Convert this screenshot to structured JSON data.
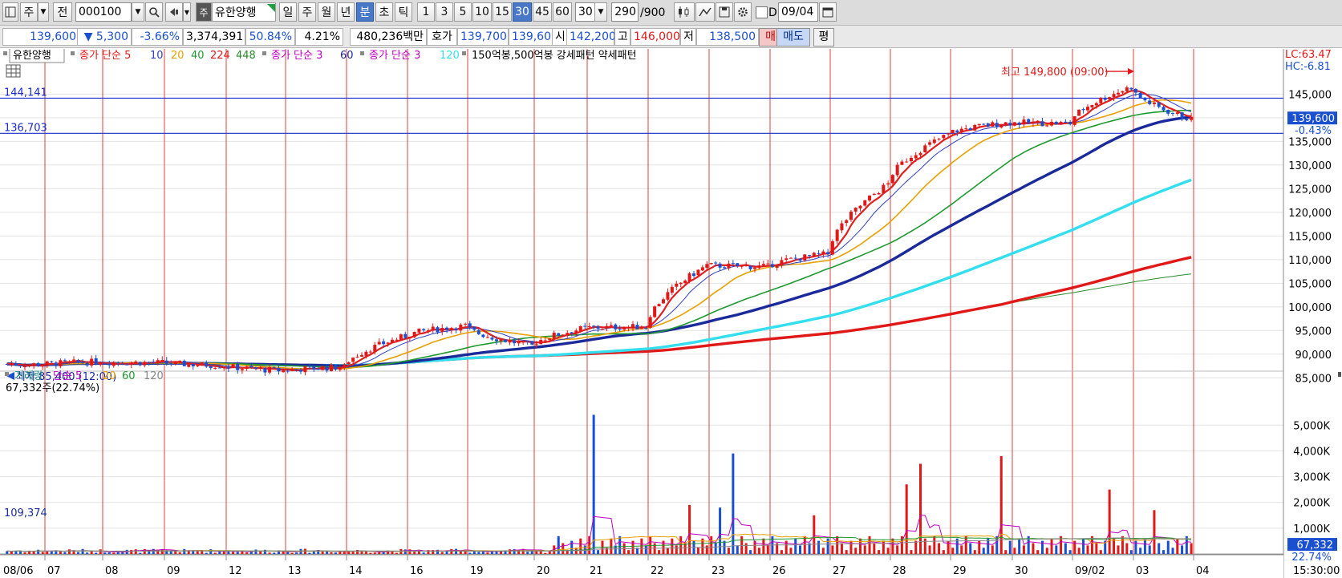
{
  "toolbar": {
    "type_label": "주",
    "prev_label": "전",
    "code": "000100",
    "type_badge": "주",
    "stock_name": "유한양행",
    "periods": [
      "일",
      "주",
      "월",
      "년",
      "분",
      "초",
      "틱"
    ],
    "selected_period": "분",
    "intervals": [
      "1",
      "3",
      "5",
      "10",
      "15",
      "30",
      "45",
      "60"
    ],
    "selected_interval": "30",
    "interval_value": "30",
    "count": "290",
    "count_total": "/900",
    "d_label": "D",
    "date": "09/04"
  },
  "quote": {
    "price": "139,600",
    "change": "▼ 5,300",
    "change_pct": "-3.66%",
    "volume": "3,374,391",
    "volume_ratio": "50.84%",
    "turnover": "4.21%",
    "amount": "480,236백만",
    "hoga_label": "호가",
    "ask": "139,700",
    "bid": "139,600",
    "open_label": "시",
    "open": "142,200",
    "high_label": "고",
    "high": "146,000",
    "low_label": "저",
    "low": "138,500",
    "buy_label": "매수",
    "sell_label": "매도",
    "eval_label": "평"
  },
  "price_legend": {
    "name": "유한양행",
    "ma_label": "종가 단순 5",
    "ma_periods": [
      "10",
      "20",
      "40",
      "224",
      "448"
    ],
    "ma2_label": "종가 단순 3",
    "ma2_period": "60",
    "ma3_label": "종가 단순 3",
    "ma3_period": "120",
    "pattern_text": "150억봉,500억봉 강세패턴  약세패턴"
  },
  "volume_legend": {
    "label": "거래량",
    "ma_label": "단순 5",
    "ma_periods": [
      "20",
      "60",
      "120"
    ],
    "current": "67,332주(22.74%)",
    "ref_value": "109,374"
  },
  "corner_labels": {
    "lc": "LC:63.47",
    "hc": "HC:-6.81",
    "time": "15:30:00"
  },
  "chart_data": {
    "type": "candlestick",
    "price_panel": {
      "ylim": [
        82000,
        151500
      ],
      "y_ticks": [
        85000,
        90000,
        95000,
        100000,
        105000,
        110000,
        115000,
        120000,
        125000,
        130000,
        135000,
        140000,
        145000
      ],
      "y_tick_labels": [
        "85,000",
        "90,000",
        "95,000",
        "100,000",
        "105,000",
        "110,000",
        "115,000",
        "120,000",
        "125,000",
        "130,000",
        "135,000",
        "140,000",
        "145,000"
      ],
      "hlines": [
        {
          "label": "144,141",
          "value": 144141
        },
        {
          "label": "136,703",
          "value": 136703
        }
      ],
      "annotations": [
        {
          "text": "최고 149,800 (09:00)",
          "value": 149800
        },
        {
          "text": "최저 85,400 (12:00)",
          "value": 85400
        }
      ],
      "current_price": {
        "label": "139,600",
        "pct": "-0.43%",
        "value": 139600
      },
      "date_separator_labels": [
        "07",
        "08",
        "09",
        "12",
        "13",
        "14",
        "16",
        "19",
        "20",
        "21",
        "22",
        "23",
        "26",
        "27",
        "28",
        "29",
        "30",
        "09/02",
        "03",
        "04"
      ],
      "daily_closes": [
        87800,
        88400,
        88200,
        87600,
        86500,
        87300,
        93800,
        96000,
        91800,
        95500,
        95800,
        108800,
        108500,
        111200,
        126000,
        136500,
        139000,
        138800,
        146500,
        139600
      ],
      "series": [
        {
          "name": "5",
          "color": "#e02020",
          "width": 2.2
        },
        {
          "name": "10",
          "color": "#3040c0",
          "width": 1
        },
        {
          "name": "20",
          "color": "#e8a000",
          "width": 1.6
        },
        {
          "name": "40",
          "color": "#1e9a30",
          "width": 1.6
        },
        {
          "name": "60",
          "color": "#1a2a9a",
          "width": 3.4
        },
        {
          "name": "120",
          "color": "#33dfee",
          "width": 3.4
        },
        {
          "name": "224",
          "color": "#e01818",
          "width": 3.4
        },
        {
          "name": "448",
          "color": "#2a8a2a",
          "width": 1
        }
      ]
    },
    "volume_panel": {
      "ylim": [
        0,
        5600
      ],
      "y_ticks": [
        1000,
        2000,
        3000,
        4000,
        5000
      ],
      "y_tick_labels": [
        "1,000K",
        "2,000K",
        "3,000K",
        "4,000K",
        "5,000K"
      ],
      "current_value": "67,332",
      "current_pct": "22.74%",
      "spikes_k": [
        5400,
        1900,
        3900,
        1800,
        1500,
        3500,
        2700,
        3800,
        2500,
        1700
      ]
    },
    "x_axis_labels": [
      "08/06",
      "07",
      "08",
      "09",
      "12",
      "13",
      "14",
      "16",
      "19",
      "20",
      "21",
      "22",
      "23",
      "26",
      "27",
      "28",
      "29",
      "30",
      "09/02",
      "03",
      "04"
    ],
    "colors": {
      "up": "#e01818",
      "down": "#1a4fd0",
      "grid_day": "#d84040",
      "grid": "#e2e2e2"
    }
  }
}
